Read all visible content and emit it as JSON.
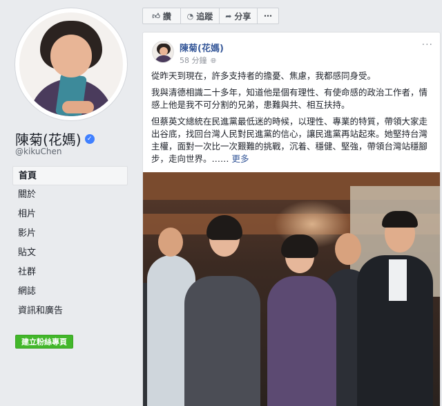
{
  "profile": {
    "name": "陳菊(花媽)",
    "handle": "@kikuChen",
    "verified_icon": "verified-badge-icon"
  },
  "nav": {
    "items": [
      {
        "label": "首頁",
        "active": true
      },
      {
        "label": "關於"
      },
      {
        "label": "相片"
      },
      {
        "label": "影片"
      },
      {
        "label": "貼文"
      },
      {
        "label": "社群"
      },
      {
        "label": "網誌"
      },
      {
        "label": "資訊和廣告"
      }
    ],
    "create_button": "建立粉絲專頁"
  },
  "actions": {
    "like": {
      "label": "讚",
      "icon": "thumbs-up-icon"
    },
    "follow": {
      "label": "追蹤",
      "icon": "rss-icon"
    },
    "share": {
      "label": "分享",
      "icon": "share-arrow-icon"
    },
    "more": {
      "label": "⋯"
    }
  },
  "post": {
    "author": "陳菊(花媽)",
    "time": "58 分鐘",
    "menu": "···",
    "paragraphs": [
      "從昨天到現在，許多支持者的擔憂、焦慮，我都感同身受。",
      "我與清德相識二十多年，知道他是個有理性、有使命感的政治工作者，情感上他是我不可分割的兄弟，患難與共、相互扶持。",
      "但蔡英文總統在民進黨最低迷的時候，以理性、專業的特質，帶領大家走出谷底，找回台灣人民對民進黨的信心，讓民進黨再站起來。她堅持台灣主權，面對一次比一次艱難的挑戰，沉着、穩健、堅強，帶領台灣站穩腳步，走向世界。……"
    ],
    "more_link": "更多"
  },
  "colors": {
    "background": "#e9ebee",
    "link": "#365899",
    "green_button": "#42b72a"
  }
}
